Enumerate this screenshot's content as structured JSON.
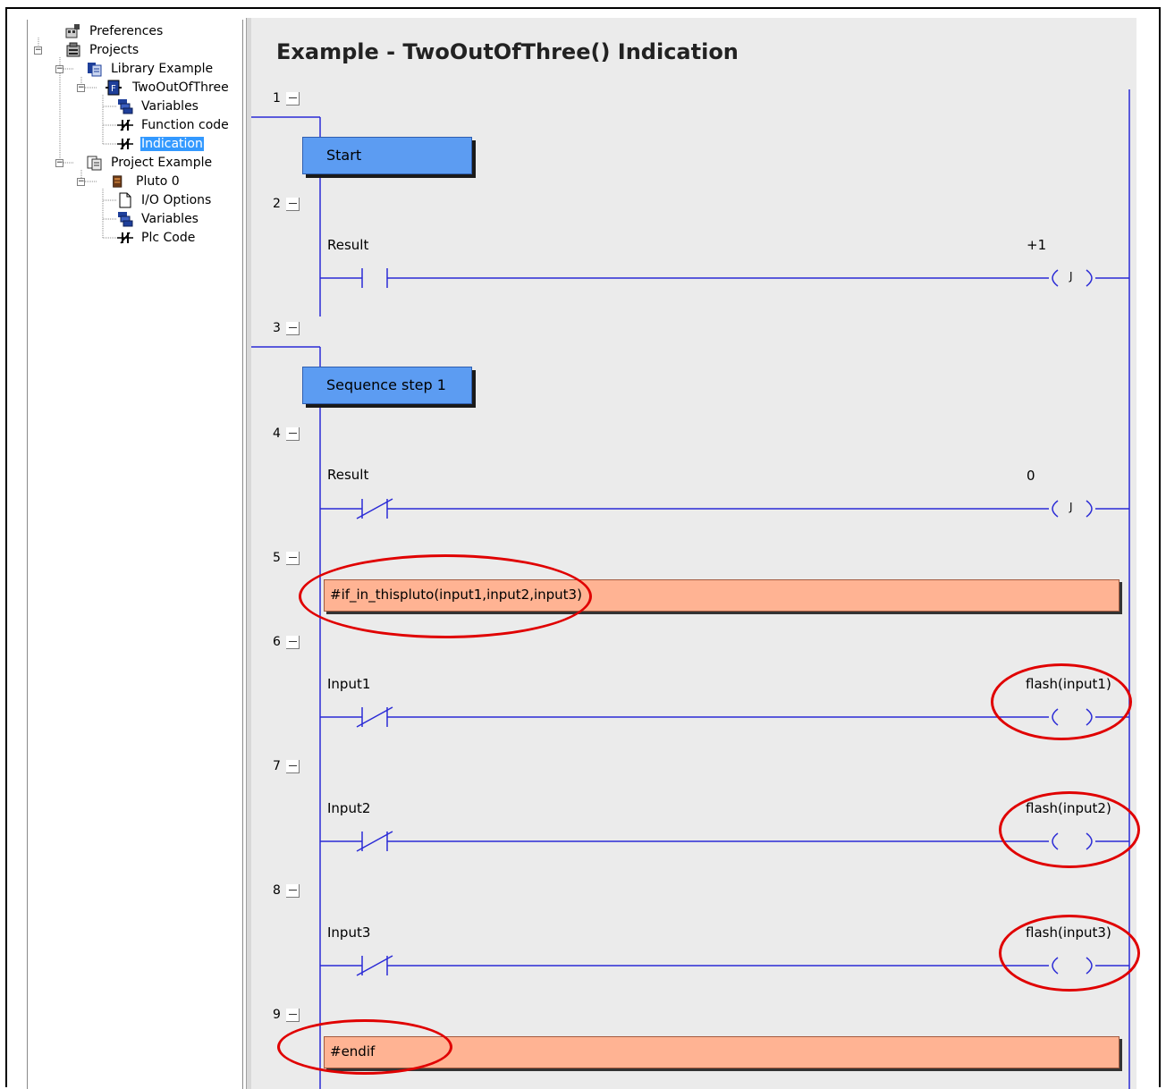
{
  "tree": {
    "items": [
      {
        "label": "Preferences",
        "icon": "preferences-icon"
      },
      {
        "label": "Projects",
        "icon": "projects-icon"
      },
      {
        "label": "Library Example",
        "icon": "library-icon"
      },
      {
        "label": "TwoOutOfThree",
        "icon": "function-block-icon"
      },
      {
        "label": "Variables",
        "icon": "variables-icon"
      },
      {
        "label": "Function code",
        "icon": "ladder-code-icon"
      },
      {
        "label": "Indication",
        "icon": "ladder-code-icon",
        "selected": true
      },
      {
        "label": "Project Example",
        "icon": "project-icon"
      },
      {
        "label": "Pluto 0",
        "icon": "plc-icon"
      },
      {
        "label": "I/O Options",
        "icon": "page-icon"
      },
      {
        "label": "Variables",
        "icon": "variables-icon"
      },
      {
        "label": "Plc Code",
        "icon": "ladder-code-icon"
      }
    ]
  },
  "editor": {
    "title": "Example - TwoOutOfThree() Indication",
    "rung_numbers": [
      "1",
      "2",
      "3",
      "4",
      "5",
      "6",
      "7",
      "8",
      "9"
    ],
    "rungs": {
      "step_start": "Start",
      "r2_contact": "Result",
      "r2_coil_value": "+1",
      "r2_coil_symbol": "J",
      "step_seq1": "Sequence step 1",
      "r4_contact": "Result",
      "r4_coil_value": "0",
      "r4_coil_symbol": "J",
      "r5_directive": "#if_in_thispluto(input1,input2,input3)",
      "r6_contact": "Input1",
      "r6_coil": "flash(input1)",
      "r7_contact": "Input2",
      "r7_coil": "flash(input2)",
      "r8_contact": "Input3",
      "r8_coil": "flash(input3)",
      "r9_directive": "#endif"
    }
  },
  "colors": {
    "wire": "#2b2bd6",
    "step_fill": "#5c9cf2",
    "directive_fill": "#ffb393",
    "callout": "#e00000",
    "selection": "#3399ff"
  }
}
